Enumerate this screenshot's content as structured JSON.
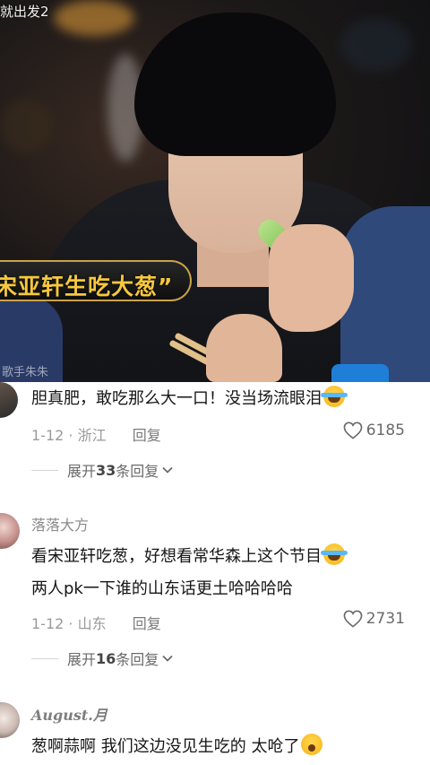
{
  "video": {
    "watermark_top": "就出发2",
    "caption": "宋亚轩生吃大葱”",
    "watermark_bottom": "歌手朱朱"
  },
  "comments": [
    {
      "username": "",
      "text": "胆真肥，敢吃那么大一口！没当场流眼泪",
      "emoji": "loudly-crying-face",
      "date": "1-12",
      "location": "浙江",
      "reply_label": "回复",
      "likes": "6185",
      "expand": {
        "prefix": "展开",
        "count": "33",
        "suffix": "条回复"
      }
    },
    {
      "username": "落落大方",
      "text_lines": [
        "看宋亚轩吃葱，好想看常华森上这个节目",
        "两人pk一下谁的山东话更土哈哈哈哈"
      ],
      "emoji": "loudly-crying-face",
      "date": "1-12",
      "location": "山东",
      "reply_label": "回复",
      "likes": "2731",
      "expand": {
        "prefix": "展开",
        "count": "16",
        "suffix": "条回复"
      }
    },
    {
      "username": "August.月",
      "text": "葱啊蒜啊 我们这边没见生吃的 太呛了",
      "emoji": "fearful-face"
    }
  ]
}
